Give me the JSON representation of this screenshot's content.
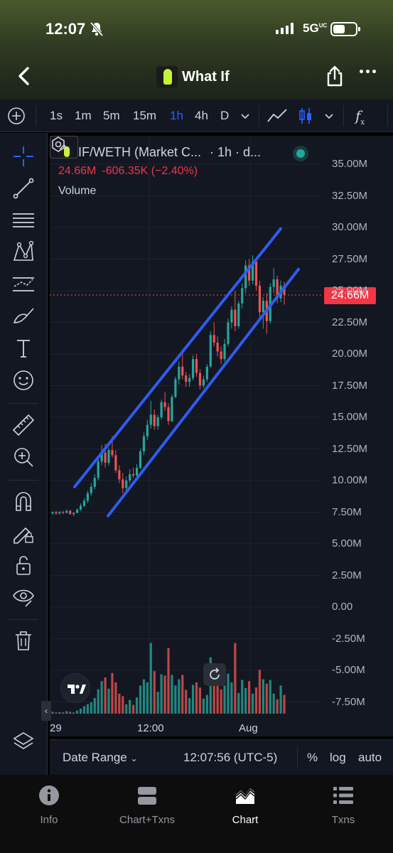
{
  "status_bar": {
    "time": "12:07",
    "network": "5G",
    "network_sup": "UC"
  },
  "header": {
    "title": "What If",
    "icons": [
      "back-chevron-icon",
      "share-icon",
      "more-dots-icon"
    ]
  },
  "toolbar": {
    "intervals": [
      "1s",
      "1m",
      "5m",
      "15m",
      "1h",
      "4h",
      "D"
    ],
    "active_interval": "1h",
    "fx_label": "f"
  },
  "left_tools": [
    "crosshair-icon",
    "trendline-icon",
    "fib-icon",
    "pattern-icon",
    "projection-icon",
    "brush-icon",
    "text-icon",
    "emoji-icon",
    "ruler-icon",
    "zoom-icon",
    "magnet-icon",
    "lock-drawing-icon",
    "unlock-icon",
    "eye-icon",
    "trash-icon",
    "layers-icon"
  ],
  "legend": {
    "symbol": "IF/WETH (Market C...",
    "interval": "· 1h · d...",
    "value": "24.66M",
    "change": "-606.35K (−2.40%)",
    "volume_label": "Volume"
  },
  "price_axis": [
    "35.00M",
    "32.50M",
    "30.00M",
    "27.50M",
    "25.00M",
    "22.50M",
    "20.00M",
    "17.50M",
    "15.00M",
    "12.50M",
    "10.00M",
    "7.50M",
    "5.00M",
    "2.50M",
    "0.00",
    "-2.50M",
    "-5.00M",
    "-7.50M"
  ],
  "current_price": "24.66M",
  "time_axis": [
    "29",
    "12:00",
    "Aug"
  ],
  "colors": {
    "up": "#26a69a",
    "down": "#ef5350",
    "accent": "#2962ff",
    "channel": "#2f5cf0",
    "background": "#131722"
  },
  "chart_data": {
    "type": "candlestick",
    "x_labels": [
      "29",
      "12:00",
      "Aug"
    ],
    "ylim": [
      -8750000,
      35000000
    ],
    "last_price": 24660000,
    "candles": [
      [
        7.4,
        7.55,
        7.3,
        7.5
      ],
      [
        7.5,
        7.6,
        7.3,
        7.4
      ],
      [
        7.4,
        7.6,
        7.3,
        7.5
      ],
      [
        7.5,
        7.6,
        7.35,
        7.45
      ],
      [
        7.45,
        7.7,
        7.4,
        7.6
      ],
      [
        7.6,
        7.7,
        7.3,
        7.35
      ],
      [
        7.35,
        7.5,
        7.2,
        7.45
      ],
      [
        7.45,
        7.8,
        7.4,
        7.7
      ],
      [
        7.7,
        8.2,
        7.6,
        8.0
      ],
      [
        8.0,
        8.6,
        7.9,
        8.4
      ],
      [
        8.4,
        9.2,
        8.2,
        9.0
      ],
      [
        9.0,
        9.8,
        8.8,
        9.5
      ],
      [
        9.5,
        10.5,
        9.3,
        10.2
      ],
      [
        10.2,
        11.8,
        10.0,
        11.5
      ],
      [
        11.5,
        12.8,
        11.2,
        12.2
      ],
      [
        12.2,
        12.9,
        11.0,
        11.4
      ],
      [
        11.4,
        12.6,
        11.2,
        12.4
      ],
      [
        12.4,
        13.5,
        11.8,
        12.0
      ],
      [
        12.0,
        12.4,
        10.6,
        10.8
      ],
      [
        10.8,
        11.2,
        9.8,
        10.1
      ],
      [
        10.1,
        10.6,
        9.0,
        9.4
      ],
      [
        9.4,
        10.3,
        9.2,
        10.0
      ],
      [
        10.0,
        10.9,
        9.8,
        10.5
      ],
      [
        10.5,
        11.0,
        10.2,
        10.4
      ],
      [
        10.4,
        11.3,
        10.3,
        11.0
      ],
      [
        11.0,
        12.5,
        10.9,
        12.3
      ],
      [
        12.3,
        13.8,
        12.0,
        13.5
      ],
      [
        13.5,
        14.8,
        13.2,
        14.4
      ],
      [
        14.4,
        16.3,
        14.1,
        15.2
      ],
      [
        15.2,
        15.6,
        14.0,
        14.3
      ],
      [
        14.3,
        15.2,
        14.0,
        15.0
      ],
      [
        15.0,
        16.4,
        14.8,
        16.2
      ],
      [
        16.2,
        17.0,
        15.5,
        15.8
      ],
      [
        15.8,
        16.1,
        14.4,
        14.7
      ],
      [
        14.7,
        16.8,
        14.6,
        16.6
      ],
      [
        16.6,
        18.2,
        16.5,
        18.0
      ],
      [
        18.0,
        19.4,
        17.6,
        19.0
      ],
      [
        19.0,
        20.2,
        18.0,
        18.3
      ],
      [
        18.3,
        18.6,
        17.4,
        17.8
      ],
      [
        17.8,
        18.4,
        17.4,
        18.1
      ],
      [
        18.1,
        19.9,
        17.9,
        19.6
      ],
      [
        19.6,
        20.0,
        18.2,
        18.5
      ],
      [
        18.5,
        18.8,
        17.2,
        17.5
      ],
      [
        17.5,
        18.3,
        17.3,
        18.0
      ],
      [
        18.0,
        19.2,
        17.8,
        19.0
      ],
      [
        19.0,
        21.8,
        18.9,
        21.5
      ],
      [
        21.5,
        22.5,
        20.6,
        20.9
      ],
      [
        20.9,
        21.4,
        19.8,
        20.2
      ],
      [
        20.2,
        20.6,
        19.2,
        19.6
      ],
      [
        19.6,
        21.2,
        19.4,
        20.8
      ],
      [
        20.8,
        22.8,
        20.6,
        22.5
      ],
      [
        22.5,
        23.8,
        22.0,
        23.5
      ],
      [
        23.5,
        25.0,
        21.8,
        22.2
      ],
      [
        22.2,
        24.2,
        22.0,
        24.0
      ],
      [
        24.0,
        25.6,
        23.6,
        25.2
      ],
      [
        25.2,
        27.4,
        24.8,
        27.0
      ],
      [
        27.0,
        27.5,
        25.4,
        25.8
      ],
      [
        25.8,
        27.8,
        25.5,
        27.3
      ],
      [
        27.3,
        27.6,
        25.0,
        25.4
      ],
      [
        25.4,
        25.8,
        22.8,
        23.3
      ],
      [
        23.3,
        24.5,
        22.0,
        24.2
      ],
      [
        24.2,
        24.8,
        21.6,
        22.6
      ],
      [
        22.6,
        25.6,
        22.4,
        25.3
      ],
      [
        25.3,
        26.8,
        24.8,
        25.9
      ],
      [
        25.9,
        26.2,
        24.0,
        24.4
      ],
      [
        24.4,
        25.8,
        24.1,
        25.4
      ],
      [
        25.4,
        25.7,
        23.9,
        24.66
      ]
    ],
    "volumes": [
      [
        0.3,
        0
      ],
      [
        0.2,
        1
      ],
      [
        0.25,
        0
      ],
      [
        0.2,
        1
      ],
      [
        0.4,
        0
      ],
      [
        0.3,
        1
      ],
      [
        0.2,
        0
      ],
      [
        0.5,
        0
      ],
      [
        0.8,
        0
      ],
      [
        1.2,
        0
      ],
      [
        1.5,
        0
      ],
      [
        1.8,
        0
      ],
      [
        2.5,
        0
      ],
      [
        3.9,
        0
      ],
      [
        5.2,
        0
      ],
      [
        5.8,
        1
      ],
      [
        4.0,
        0
      ],
      [
        6.5,
        1
      ],
      [
        5.0,
        1
      ],
      [
        3.2,
        1
      ],
      [
        2.8,
        1
      ],
      [
        1.5,
        0
      ],
      [
        2.2,
        0
      ],
      [
        1.4,
        1
      ],
      [
        2.6,
        0
      ],
      [
        4.5,
        0
      ],
      [
        5.5,
        0
      ],
      [
        5.0,
        0
      ],
      [
        11.3,
        0
      ],
      [
        6.8,
        1
      ],
      [
        3.5,
        0
      ],
      [
        6.3,
        0
      ],
      [
        6.1,
        1
      ],
      [
        10.5,
        1
      ],
      [
        6.2,
        0
      ],
      [
        4.5,
        0
      ],
      [
        5.5,
        0
      ],
      [
        6.2,
        1
      ],
      [
        3.8,
        1
      ],
      [
        2.5,
        0
      ],
      [
        4.6,
        0
      ],
      [
        5.0,
        1
      ],
      [
        4.2,
        1
      ],
      [
        2.4,
        0
      ],
      [
        3.0,
        0
      ],
      [
        9.0,
        0
      ],
      [
        7.8,
        1
      ],
      [
        5.2,
        1
      ],
      [
        3.9,
        1
      ],
      [
        4.5,
        0
      ],
      [
        6.4,
        0
      ],
      [
        5.0,
        0
      ],
      [
        11.3,
        1
      ],
      [
        3.3,
        0
      ],
      [
        5.4,
        0
      ],
      [
        4.1,
        0
      ],
      [
        5.2,
        1
      ],
      [
        3.2,
        0
      ],
      [
        4.2,
        1
      ],
      [
        7.0,
        1
      ],
      [
        5.5,
        0
      ],
      [
        4.8,
        1
      ],
      [
        5.4,
        0
      ],
      [
        3.2,
        0
      ],
      [
        2.3,
        1
      ],
      [
        4.5,
        0
      ],
      [
        3.0,
        1
      ]
    ]
  },
  "date_bar": {
    "range_label": "Date Range",
    "time": "12:07:56 (UTC-5)",
    "percent": "%",
    "log": "log",
    "auto": "auto"
  },
  "bottom_nav": [
    {
      "label": "Info",
      "icon": "info-icon"
    },
    {
      "label": "Chart+Txns",
      "icon": "split-icon"
    },
    {
      "label": "Chart",
      "icon": "chart-icon"
    },
    {
      "label": "Txns",
      "icon": "list-icon"
    }
  ],
  "active_nav": "Chart"
}
